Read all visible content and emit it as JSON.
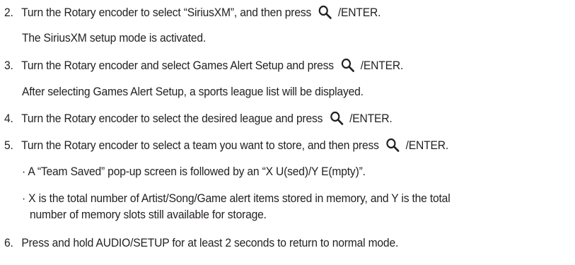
{
  "steps": [
    {
      "number": "2.",
      "before": "Turn the Rotary encoder to select “SiriusXM”, and then press",
      "after": "/ENTER."
    },
    {
      "note": "The SiriusXM setup mode is activated."
    },
    {
      "number": "3.",
      "before": "Turn the Rotary encoder and select Games Alert Setup and press",
      "after": "/ENTER."
    },
    {
      "note": "After selecting Games Alert Setup, a sports league list will be displayed."
    },
    {
      "number": "4.",
      "before": "Turn the Rotary encoder to select the desired league and press",
      "after": "/ENTER."
    },
    {
      "number": "5.",
      "before": "Turn the Rotary encoder to select a team you want to store, and then press",
      "after": "/ENTER."
    },
    {
      "bullet": "· A “Team Saved” pop-up screen is followed by an “X U(sed)/Y E(mpty)”."
    },
    {
      "bullet": "· X is the total number of Artist/Song/Game alert items stored in memory, and Y is the total",
      "continuation": "number of memory slots still available for storage."
    },
    {
      "number": "6.",
      "text": "Press and hold AUDIO/SETUP for at least 2 seconds to return to normal mode."
    }
  ],
  "icons": {
    "search": "search-icon"
  }
}
